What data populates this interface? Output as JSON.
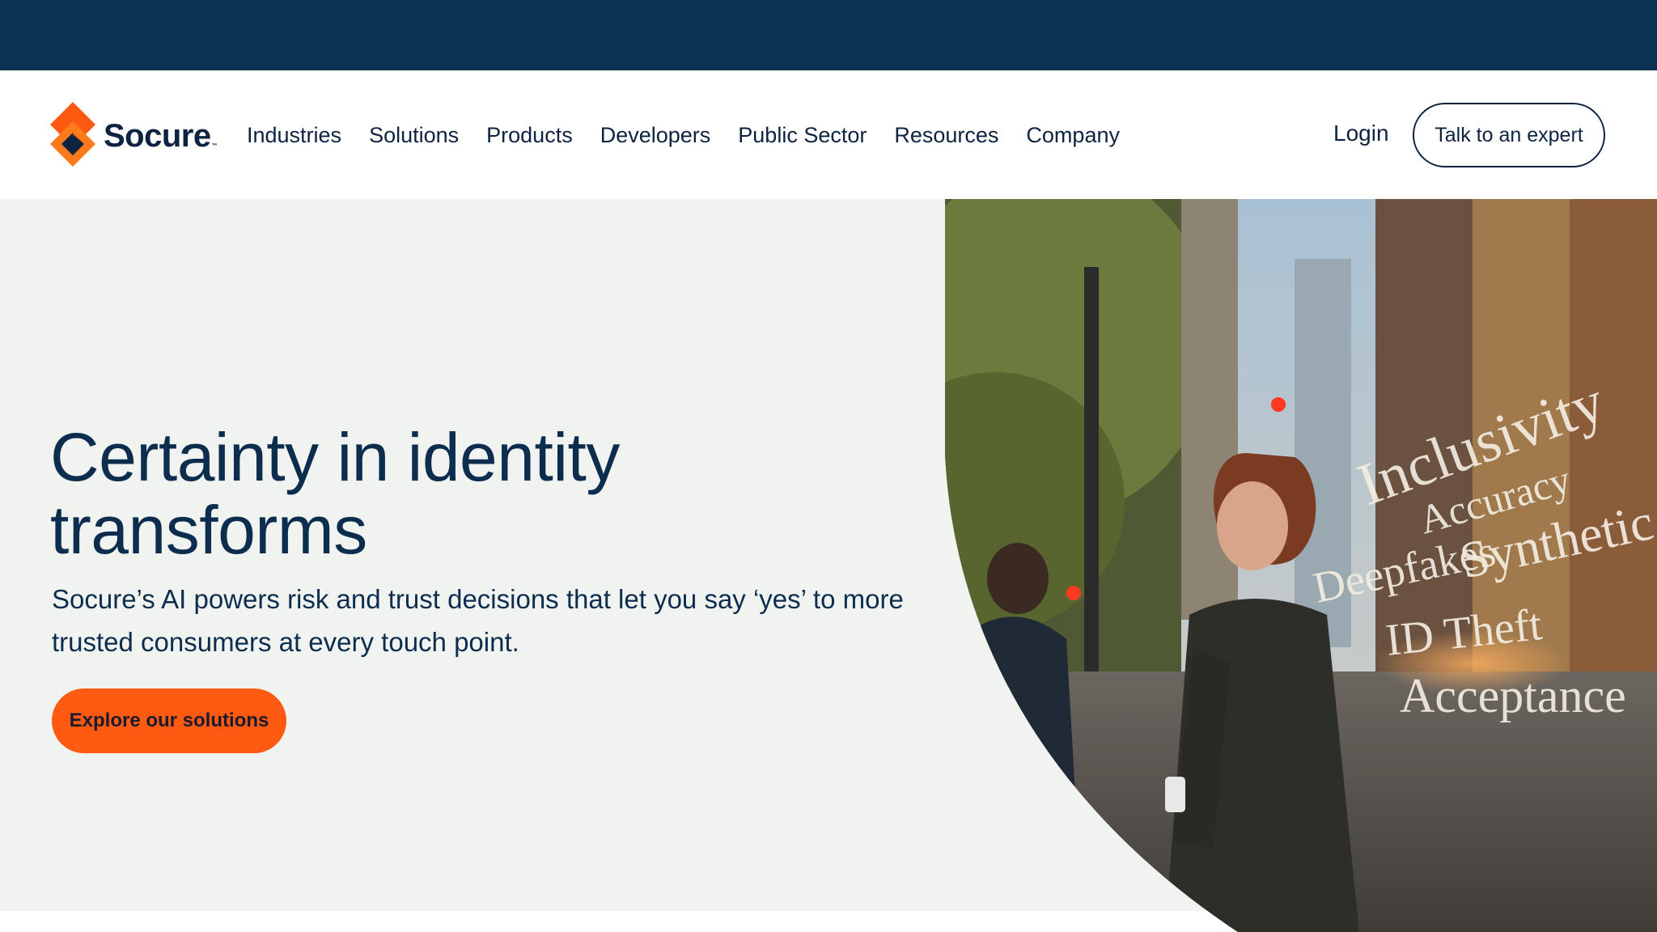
{
  "brand": {
    "name": "Socure",
    "tm": "™",
    "colors": {
      "navy": "#0b3153",
      "orange": "#ff5a12",
      "text": "#0d2d4f",
      "hero_bg": "#f1f3f1"
    }
  },
  "nav": {
    "items": [
      {
        "label": "Industries"
      },
      {
        "label": "Solutions"
      },
      {
        "label": "Products"
      },
      {
        "label": "Developers"
      },
      {
        "label": "Public Sector"
      },
      {
        "label": "Resources"
      },
      {
        "label": "Company"
      }
    ],
    "login_label": "Login",
    "cta_label": "Talk to an expert"
  },
  "hero": {
    "title_line1": "Certainty in identity",
    "title_line2": "transforms",
    "subtitle": "Socure’s AI powers risk and trust decisions that let you say ‘yes’ to more trusted consumers at every touch point.",
    "button_label": "Explore our solutions",
    "image_words": [
      "Inclusivity",
      "Accuracy",
      "Deepfakes",
      "Synthetic",
      "ID Theft",
      "Acceptance"
    ]
  }
}
